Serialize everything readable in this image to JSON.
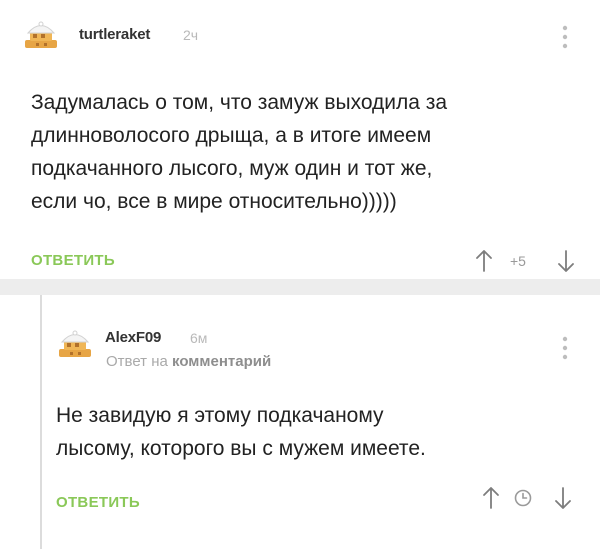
{
  "colors": {
    "accent": "#8ac858",
    "text": "#222222",
    "muted": "#b9b9b9",
    "separator": "#ededed"
  },
  "comments": [
    {
      "username": "turtleraket",
      "time": "2ч",
      "text": "Задумалась о том, что замуж выходила за\nдлинноволосого дрыща, а в итоге имеем\nподкачанного лысого, муж один и тот же,\nесли чо, все в мире относительно)))))",
      "action_label": "ОТВЕТИТЬ",
      "rating": "+5",
      "icons": [
        "avatar-icon",
        "more-vertical-icon",
        "arrow-up-icon",
        "arrow-down-icon"
      ]
    },
    {
      "username": "AlexF09",
      "time": "6м",
      "reply_to_prefix": "Ответ на",
      "reply_to_target": "комментарий",
      "text": "Не завидую я этому подкачаному\nлысому, которого вы с мужем имеете.",
      "action_label": "ОТВЕТИТЬ",
      "icons": [
        "avatar-icon",
        "more-vertical-icon",
        "arrow-up-icon",
        "clock-icon",
        "arrow-down-icon"
      ]
    }
  ]
}
